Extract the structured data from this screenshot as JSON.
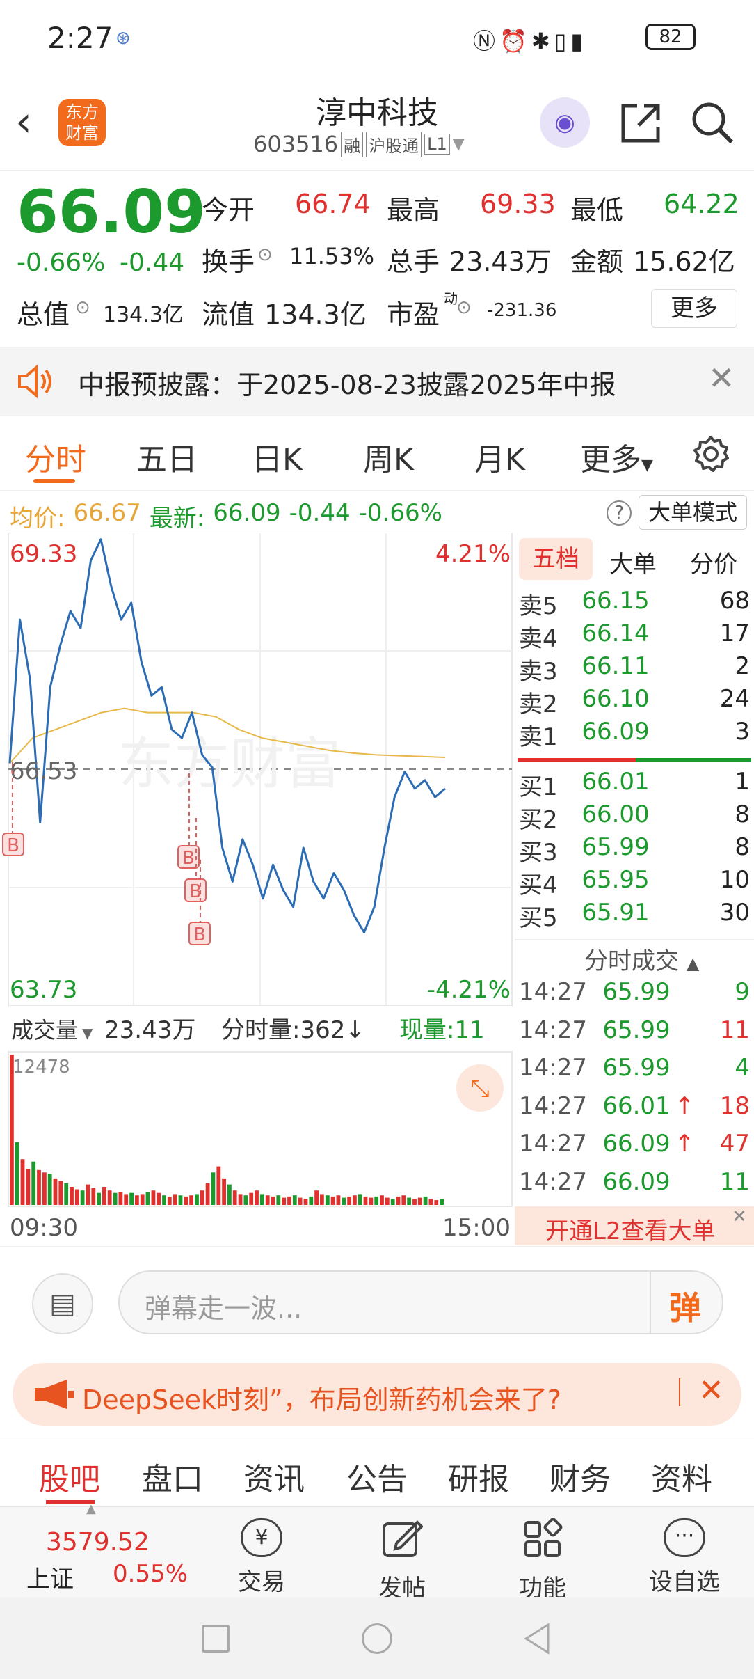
{
  "status": {
    "time": "2:27",
    "battery": "82"
  },
  "header": {
    "logo_text": "东方财富",
    "stock_name": "淳中科技",
    "stock_code": "603516",
    "badges": [
      "融",
      "沪股通",
      "L1"
    ]
  },
  "quote": {
    "price": "66.09",
    "change_pct": "-0.66%",
    "change": "-0.44",
    "open_label": "今开",
    "open": "66.74",
    "high_label": "最高",
    "high": "69.33",
    "low_label": "最低",
    "low": "64.22",
    "turnover_label": "换手",
    "turnover": "11.53%",
    "volume_label": "总手",
    "volume": "23.43万",
    "amount_label": "金额",
    "amount": "15.62亿",
    "mktcap_label": "总值",
    "mktcap": "134.3亿",
    "float_label": "流值",
    "float_cap": "134.3亿",
    "pe_label": "市盈",
    "pe_sup": "动",
    "pe": "-231.36",
    "more_label": "更多"
  },
  "notice": {
    "text": "中报预披露：于2025-08-23披露2025年中报"
  },
  "chart_tabs": [
    "分时",
    "五日",
    "日K",
    "周K",
    "月K",
    "更多"
  ],
  "infobar": {
    "avg_label": "均价:",
    "avg": "66.67",
    "last_label": "最新:",
    "last": "66.09",
    "chg": "-0.44",
    "chg_pct": "-0.66%",
    "mode_button": "大单模式"
  },
  "chart_labels": {
    "top_price": "69.33",
    "top_pct": "4.21%",
    "mid_price": "66.53",
    "bottom_price": "63.73",
    "bottom_pct": "-4.21%",
    "marker": "B",
    "watermark": "东方财富"
  },
  "volume_bar": {
    "label": "成交量",
    "total": "23.43万",
    "period_label": "分时量:362↓",
    "now_label": "现量:11",
    "max": "12478",
    "start_time": "09:30",
    "end_time": "15:00"
  },
  "chart_data": {
    "type": "line",
    "x_range": [
      "09:30",
      "15:00"
    ],
    "ylim": [
      63.73,
      69.33
    ],
    "ref_price": 66.53,
    "series": [
      {
        "values": [
          66.6,
          68.3,
          67.6,
          65.9,
          67.5,
          68.0,
          68.4,
          68.2,
          69.0,
          69.25,
          68.7,
          68.3,
          68.5,
          67.8,
          67.4,
          67.5,
          67.0,
          66.9,
          67.2,
          66.7,
          66.55,
          65.6,
          65.2,
          65.7,
          65.4,
          65.0,
          65.4,
          65.1,
          64.9,
          65.6,
          65.2,
          65.0,
          65.3,
          65.1,
          64.8,
          64.6,
          64.9,
          65.6,
          66.2,
          66.5,
          66.3,
          66.4,
          66.2,
          66.3
        ]
      },
      {
        "values": [
          66.6,
          66.9,
          67.0,
          67.1,
          67.2,
          67.25,
          67.2,
          67.2,
          67.2,
          67.15,
          67.0,
          66.9,
          66.85,
          66.8,
          66.75,
          66.72,
          66.7,
          66.69,
          66.68,
          66.67
        ]
      }
    ],
    "volume": {
      "max": 12478,
      "values": [
        12478,
        5200,
        3800,
        3000,
        3600,
        2900,
        2700,
        2600,
        2200,
        2000,
        1800,
        1500,
        1300,
        1200,
        1700,
        1400,
        1000,
        1500,
        1200,
        1000,
        1100,
        900,
        1000,
        800,
        900,
        1100,
        1200,
        1000,
        800,
        700,
        900,
        800,
        700,
        800,
        900,
        1200,
        1800,
        2700,
        3200,
        2200,
        1700,
        1200,
        900,
        800,
        1000,
        1200,
        900,
        800,
        700,
        800,
        600,
        700,
        800,
        600,
        500,
        700,
        1200,
        900,
        800,
        700,
        800,
        600,
        700,
        800,
        900,
        700,
        600,
        700,
        800,
        600,
        500,
        700,
        800,
        600,
        500,
        600,
        700,
        500,
        400,
        500
      ]
    }
  },
  "order_book": {
    "tabs": [
      "五档",
      "大单",
      "分价"
    ],
    "asks": [
      {
        "label": "卖5",
        "price": "66.15",
        "vol": "68"
      },
      {
        "label": "卖4",
        "price": "66.14",
        "vol": "17"
      },
      {
        "label": "卖3",
        "price": "66.11",
        "vol": "2"
      },
      {
        "label": "卖2",
        "price": "66.10",
        "vol": "24"
      },
      {
        "label": "卖1",
        "price": "66.09",
        "vol": "3"
      }
    ],
    "bids": [
      {
        "label": "买1",
        "price": "66.01",
        "vol": "1"
      },
      {
        "label": "买2",
        "price": "66.00",
        "vol": "8"
      },
      {
        "label": "买3",
        "price": "65.99",
        "vol": "8"
      },
      {
        "label": "买4",
        "price": "65.95",
        "vol": "10"
      },
      {
        "label": "买5",
        "price": "65.91",
        "vol": "30"
      }
    ],
    "trades_title": "分时成交",
    "trades": [
      {
        "time": "14:27",
        "price": "65.99",
        "arrow": "",
        "vol": "9",
        "color": "#1d9a2e"
      },
      {
        "time": "14:27",
        "price": "65.99",
        "arrow": "",
        "vol": "11",
        "color": "#e0312f"
      },
      {
        "time": "14:27",
        "price": "65.99",
        "arrow": "",
        "vol": "4",
        "color": "#1d9a2e"
      },
      {
        "time": "14:27",
        "price": "66.01",
        "arrow": "↑",
        "vol": "18",
        "color": "#e0312f"
      },
      {
        "time": "14:27",
        "price": "66.09",
        "arrow": "↑",
        "vol": "47",
        "color": "#e0312f"
      },
      {
        "time": "14:27",
        "price": "66.09",
        "arrow": "",
        "vol": "11",
        "color": "#1d9a2e"
      }
    ],
    "l2_button": "开通L2查看大单"
  },
  "danmu": {
    "placeholder": "弹幕走一波...",
    "send_label": "弹"
  },
  "banner": {
    "text": "DeepSeek时刻”，布局创新药机会来了?"
  },
  "bottom_tabs": [
    "股吧",
    "盘口",
    "资讯",
    "公告",
    "研报",
    "财务",
    "资料"
  ],
  "index": {
    "name": "上证",
    "value": "3579.52",
    "pct": "0.55%"
  },
  "actions": [
    {
      "label": "交易",
      "icon": "trade-icon"
    },
    {
      "label": "发帖",
      "icon": "post-icon"
    },
    {
      "label": "功能",
      "icon": "function-icon"
    },
    {
      "label": "设自选",
      "icon": "add-watchlist-icon"
    }
  ],
  "colors": {
    "accent": "#f26a1b",
    "up": "#e0312f",
    "down": "#1d9a2e",
    "price_line": "#2b6cb5",
    "avg_line": "#e8b84a"
  }
}
